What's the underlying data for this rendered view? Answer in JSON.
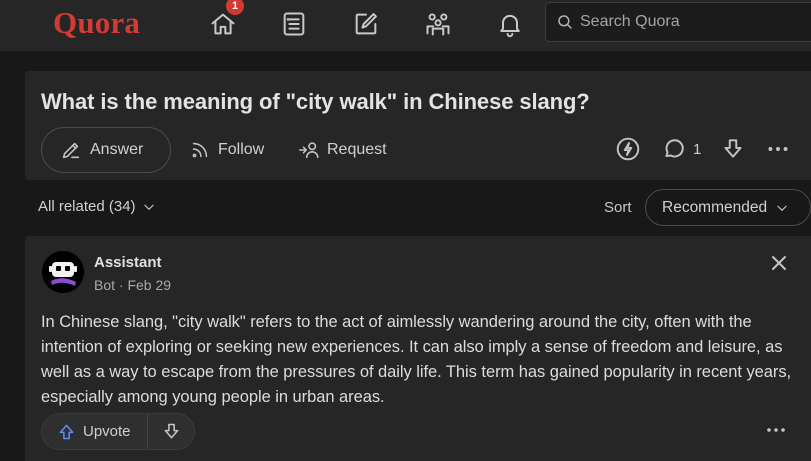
{
  "header": {
    "logo": "Quora",
    "notification_count": "1",
    "search_placeholder": "Search Quora",
    "nav_icons": [
      "home-icon",
      "following-icon",
      "answer-icon",
      "spaces-icon",
      "notifications-icon"
    ]
  },
  "question": {
    "title": "What is the meaning of \"city walk\" in Chinese slang?",
    "actions": {
      "answer": "Answer",
      "follow": "Follow",
      "request": "Request"
    },
    "comment_count": "1"
  },
  "filter": {
    "all_related": "All related (34)",
    "sort_label": "Sort",
    "sort_value": "Recommended"
  },
  "answer": {
    "author": "Assistant",
    "meta": "Bot · Feb 29",
    "body": "In Chinese slang, \"city walk\" refers to the act of aimlessly wandering around the city, often with the intention of exploring or seeking new experiences. It can also imply a sense of freedom and leisure, as well as a way to escape from the pressures of daily life. This term has gained popularity in recent years, especially among young people in urban areas.",
    "upvote_label": "Upvote"
  },
  "colors": {
    "brand": "#d33a34",
    "background": "#181818",
    "card": "#262626",
    "upvote_accent": "#5a8df0"
  }
}
